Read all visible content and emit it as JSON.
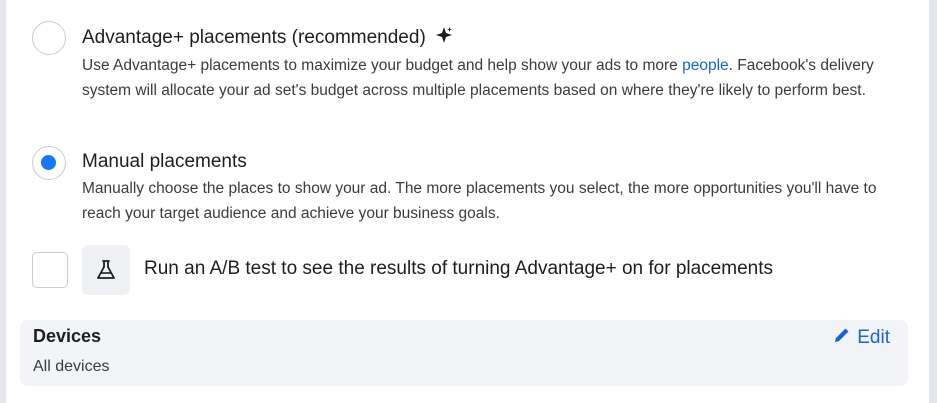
{
  "placements": {
    "advantage": {
      "title": "Advantage+ placements (recommended)",
      "desc_before_link": "Use Advantage+ placements to maximize your budget and help show your ads to more ",
      "desc_link": "people",
      "desc_after_link": ". Facebook's delivery system will allocate your ad set's budget across multiple placements based on where they're likely to perform best.",
      "selected": false,
      "icon": "sparkle-icon"
    },
    "manual": {
      "title": "Manual placements",
      "desc": "Manually choose the places to show your ad. The more placements you select, the more opportunities you'll have to reach your target audience and achieve your business goals.",
      "selected": true
    }
  },
  "ab_test": {
    "label": "Run an A/B test to see the results of turning Advantage+ on for placements",
    "checked": false,
    "icon": "flask-icon"
  },
  "devices": {
    "title": "Devices",
    "value": "All devices",
    "edit_label": "Edit",
    "edit_icon": "pencil-icon"
  },
  "colors": {
    "accent": "#1877f2",
    "link": "#1664d9",
    "card_bg": "#f3f4f7"
  }
}
